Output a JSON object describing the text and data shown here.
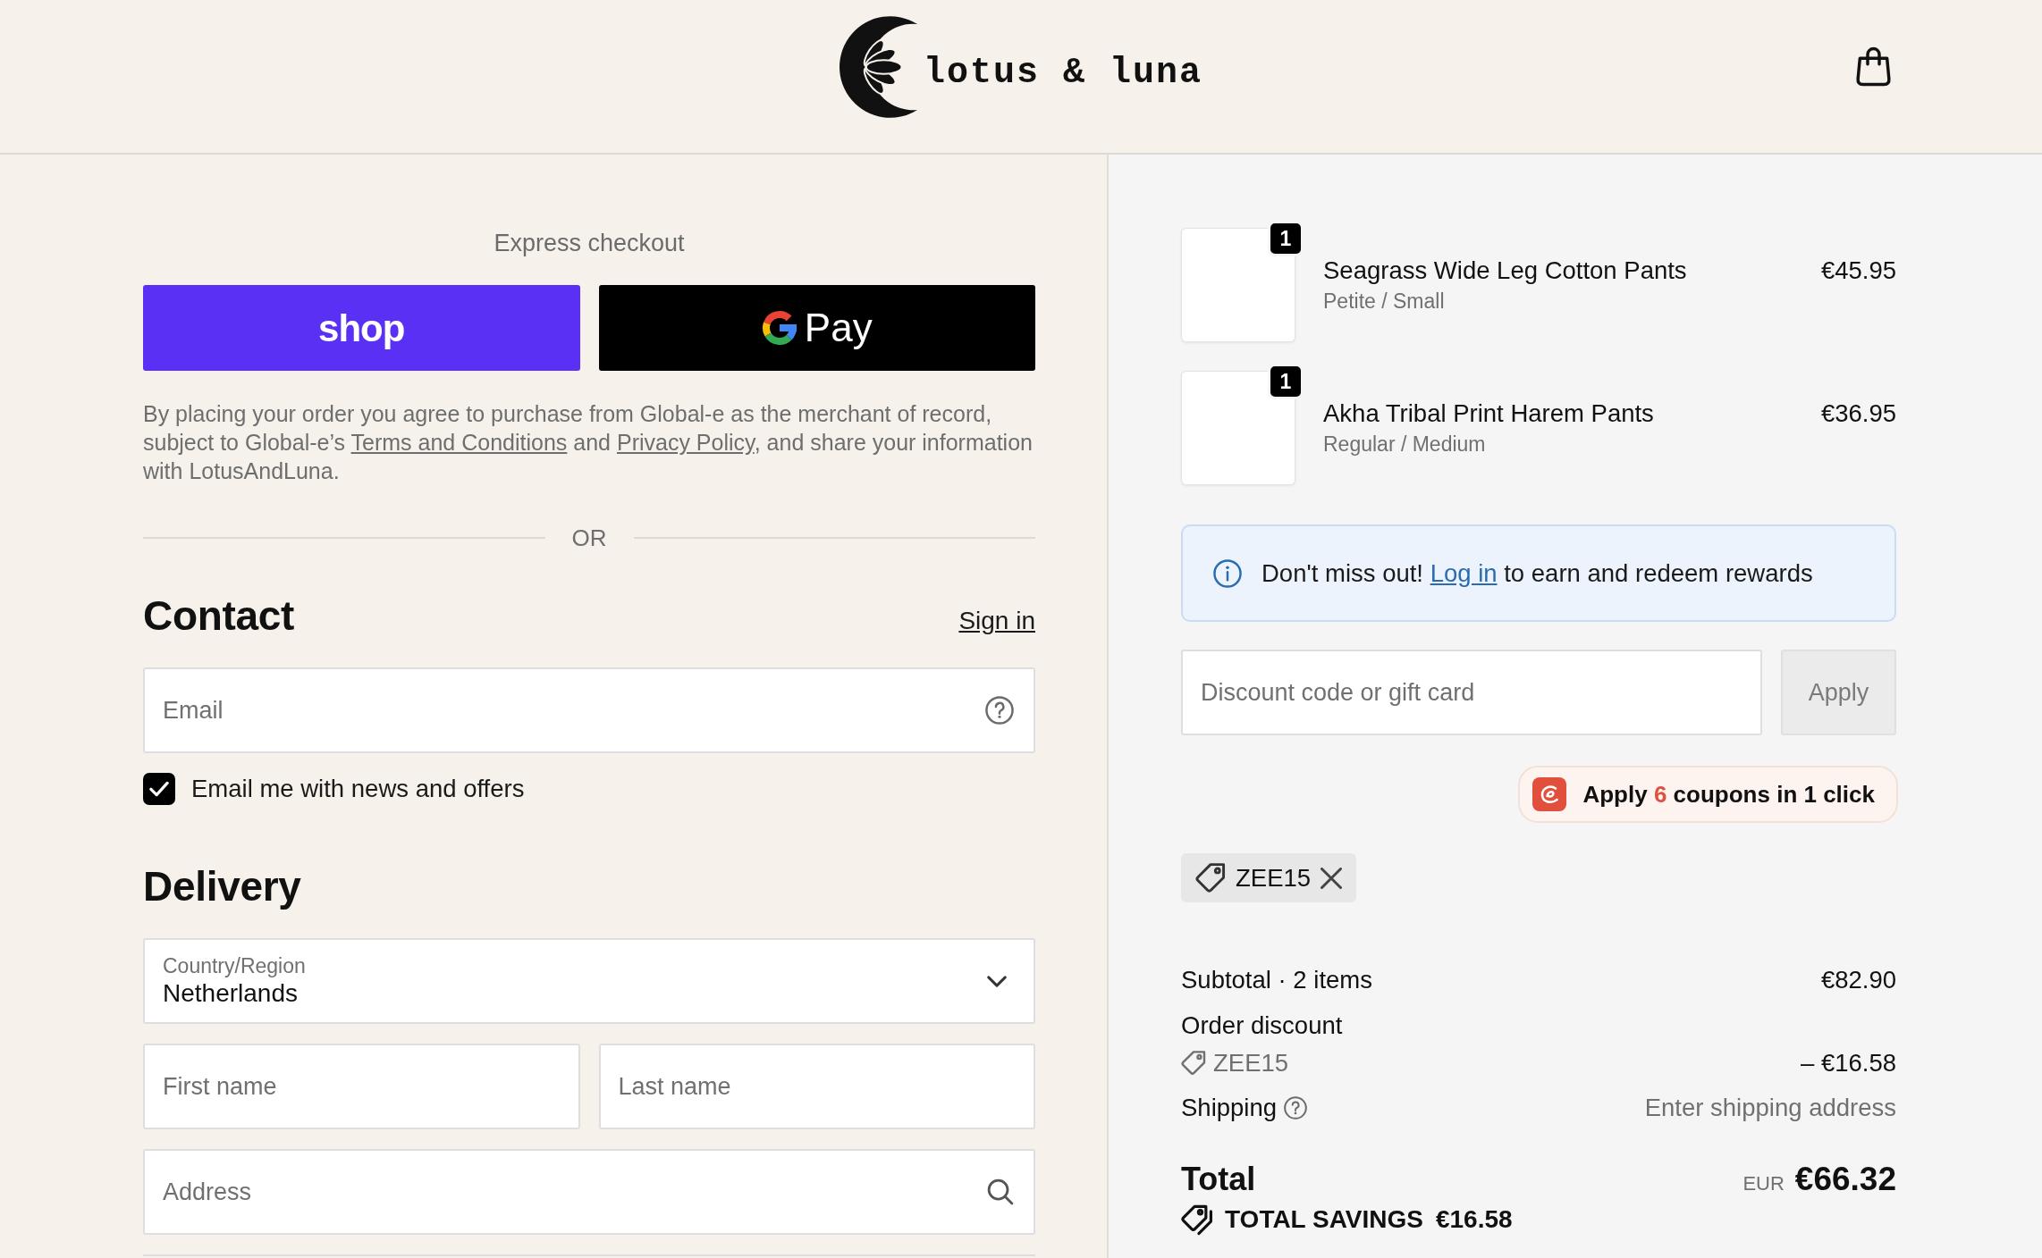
{
  "header": {
    "logo_text": "lotus & luna"
  },
  "express_checkout": {
    "title": "Express checkout",
    "buttons": [
      {
        "kind": "shop",
        "label": "shop"
      },
      {
        "kind": "gpay",
        "label": "Pay"
      }
    ]
  },
  "legal_notice": [
    {
      "kind": "text",
      "text": "By placing your order you agree to purchase from Global-e as the merchant of record, subject to Global-e’s "
    },
    {
      "kind": "link",
      "text": "Terms and Conditions"
    },
    {
      "kind": "text",
      "text": " and "
    },
    {
      "kind": "link",
      "text": "Privacy Policy"
    },
    {
      "kind": "text",
      "text": ", and share your information with LotusAndLuna."
    }
  ],
  "divider_text": "OR",
  "contact": {
    "title": "Contact",
    "sign_in": "Sign in",
    "email": {
      "placeholder": "Email"
    },
    "newsletter": {
      "label": "Email me with news and offers",
      "checked": true
    }
  },
  "delivery": {
    "title": "Delivery",
    "rows": [
      {
        "fields": [
          {
            "kind": "select",
            "label": "Country/Region",
            "value": "Netherlands"
          }
        ]
      },
      {
        "fields": [
          {
            "kind": "text",
            "placeholder": "First name"
          },
          {
            "kind": "text",
            "placeholder": "Last name"
          }
        ]
      },
      {
        "fields": [
          {
            "kind": "search",
            "placeholder": "Address"
          }
        ]
      }
    ]
  },
  "order_summary": {
    "items": [
      {
        "name": "Seagrass Wide Leg Cotton Pants",
        "variant": "Petite / Small",
        "price": "€45.95",
        "quantity": "1"
      },
      {
        "name": "Akha Tribal Print Harem Pants",
        "variant": "Regular / Medium",
        "price": "€36.95",
        "quantity": "1"
      }
    ],
    "rewards_banner": {
      "before": "Don't miss out! ",
      "link": "Log in",
      "after": " to earn and redeem rewards"
    },
    "discount": {
      "placeholder": "Discount code or gift card",
      "button": "Apply",
      "disabled": true
    },
    "coupon_extension": {
      "before": "Apply ",
      "count": "6",
      "after": " coupons in 1 click"
    },
    "applied_codes": [
      {
        "code": "ZEE15"
      }
    ],
    "lines": [
      {
        "kind": "subtotal",
        "label": "Subtotal · 2 items",
        "value": "€82.90"
      },
      {
        "kind": "discount",
        "label": "Order discount",
        "code": "ZEE15",
        "value": "– €16.58"
      },
      {
        "kind": "shipping",
        "label": "Shipping",
        "value": "Enter shipping address"
      }
    ],
    "total": {
      "label": "Total",
      "currency": "EUR",
      "value": "€66.32"
    },
    "savings": {
      "label": "TOTAL SAVINGS",
      "value": "€16.58"
    }
  }
}
